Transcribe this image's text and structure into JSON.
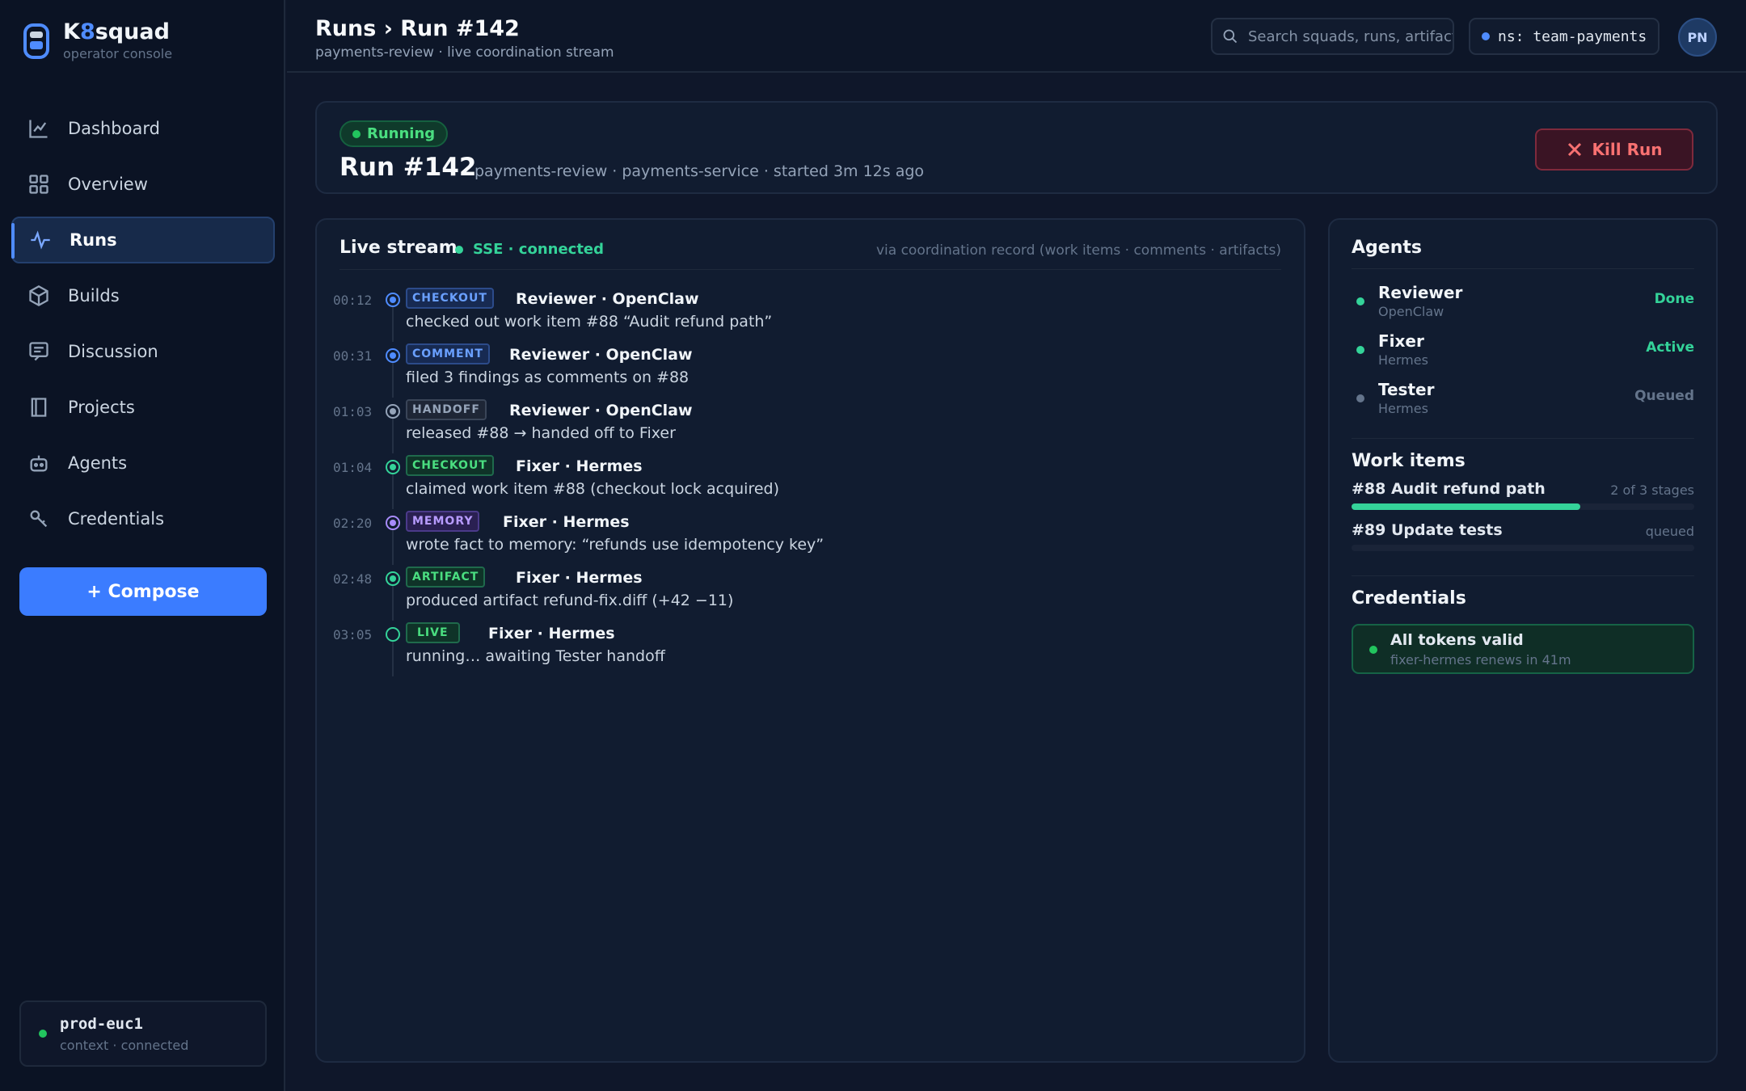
{
  "brand": {
    "name_pre": "K",
    "name_accent": "8",
    "name_post": "squad",
    "subtitle": "operator console"
  },
  "sidebar": {
    "items": [
      {
        "label": "Dashboard",
        "icon": "chart-line-icon"
      },
      {
        "label": "Overview",
        "icon": "grid-icon"
      },
      {
        "label": "Runs",
        "icon": "activity-icon",
        "active": true
      },
      {
        "label": "Builds",
        "icon": "cube-icon"
      },
      {
        "label": "Discussion",
        "icon": "message-icon"
      },
      {
        "label": "Projects",
        "icon": "book-icon"
      },
      {
        "label": "Agents",
        "icon": "robot-icon"
      },
      {
        "label": "Credentials",
        "icon": "key-icon"
      }
    ],
    "compose_label": "+ Compose",
    "context": {
      "name": "prod-euc1",
      "status": "context · connected"
    }
  },
  "header": {
    "breadcrumb": "Runs › Run #142",
    "subtitle": "payments-review · live coordination stream",
    "search_placeholder": "Search squads, runs, artifacts...",
    "namespace": "ns: team-payments",
    "avatar_initials": "PN"
  },
  "run": {
    "status": "Running",
    "title": "Run #142",
    "meta": "payments-review · payments-service · started 3m 12s ago",
    "kill_label": "Kill Run"
  },
  "stream": {
    "title": "Live stream",
    "connection": "SSE · connected",
    "via": "via coordination record (work items · comments · artifacts)",
    "events": [
      {
        "time": "00:12",
        "tag": "CHECKOUT",
        "tone": "blue",
        "actor": "Reviewer · OpenClaw",
        "desc": "checked out work item #88 “Audit refund path”"
      },
      {
        "time": "00:31",
        "tag": "COMMENT",
        "tone": "blue",
        "actor": "Reviewer · OpenClaw",
        "desc": "filed 3 findings as comments on #88"
      },
      {
        "time": "01:03",
        "tag": "HANDOFF",
        "tone": "gray",
        "actor": "Reviewer · OpenClaw",
        "desc": "released #88 → handed off to Fixer"
      },
      {
        "time": "01:04",
        "tag": "CHECKOUT",
        "tone": "green",
        "actor": "Fixer · Hermes",
        "desc": "claimed work item #88 (checkout lock acquired)"
      },
      {
        "time": "02:20",
        "tag": "MEMORY",
        "tone": "purple",
        "actor": "Fixer · Hermes",
        "desc": "wrote fact to memory: “refunds use idempotency key”"
      },
      {
        "time": "02:48",
        "tag": "ARTIFACT",
        "tone": "green",
        "actor": "Fixer · Hermes",
        "desc": "produced artifact refund-fix.diff (+42 −11)"
      },
      {
        "time": "03:05",
        "tag": "LIVE",
        "tone": "live",
        "actor": "Fixer · Hermes",
        "desc": "running… awaiting Tester handoff"
      }
    ]
  },
  "agents": {
    "title": "Agents",
    "items": [
      {
        "name": "Reviewer",
        "role": "OpenClaw",
        "state": "Done",
        "tone": "done"
      },
      {
        "name": "Fixer",
        "role": "Hermes",
        "state": "Active",
        "tone": "active"
      },
      {
        "name": "Tester",
        "role": "Hermes",
        "state": "Queued",
        "tone": "queued"
      }
    ]
  },
  "work_items": {
    "title": "Work items",
    "items": [
      {
        "name": "#88 Audit refund path",
        "state": "2 of 3 stages",
        "progress": 0.667
      },
      {
        "name": "#89 Update tests",
        "state": "queued",
        "progress": 0
      }
    ]
  },
  "credentials": {
    "title": "Credentials",
    "status": "All tokens valid",
    "detail": "fixer-hermes renews in 41m"
  },
  "colors": {
    "accent": "#3b7cff",
    "success": "#34d399",
    "danger": "#f87171",
    "background": "#0f172a"
  }
}
